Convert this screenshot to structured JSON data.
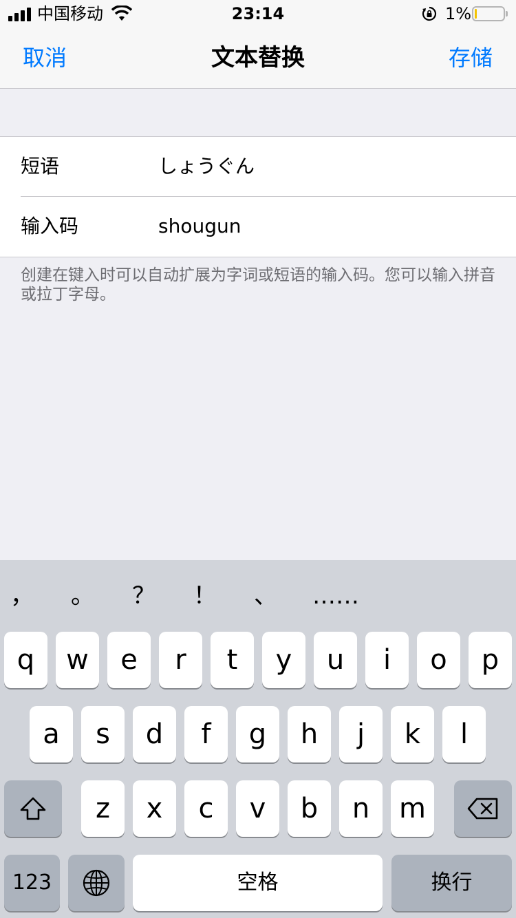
{
  "status_bar": {
    "carrier": "中国移动",
    "time": "23:14",
    "battery_percent": "1%"
  },
  "nav": {
    "cancel_label": "取消",
    "title": "文本替换",
    "save_label": "存储"
  },
  "form": {
    "phrase_label": "短语",
    "phrase_value": "しょうぐん",
    "shortcut_label": "输入码",
    "shortcut_value": "shougun",
    "footer_note": "创建在键入时可以自动扩展为字词或短语的输入码。您可以输入拼音或拉丁字母。"
  },
  "keyboard": {
    "candidates": [
      "，",
      "。",
      "？",
      "！",
      "、",
      "……"
    ],
    "row1": [
      "q",
      "w",
      "e",
      "r",
      "t",
      "y",
      "u",
      "i",
      "o",
      "p"
    ],
    "row2": [
      "a",
      "s",
      "d",
      "f",
      "g",
      "h",
      "j",
      "k",
      "l"
    ],
    "row3": [
      "z",
      "x",
      "c",
      "v",
      "b",
      "n",
      "m"
    ],
    "numbers_label": "123",
    "space_label": "空格",
    "return_label": "换行"
  }
}
